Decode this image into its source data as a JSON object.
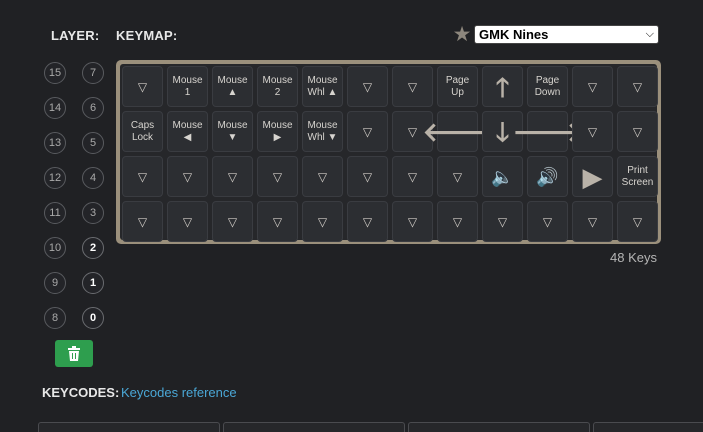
{
  "header": {
    "layer_label": "LAYER:",
    "keymap_label": "KEYMAP:"
  },
  "keymap_select": {
    "value": "GMK Nines",
    "chevron": "⌵",
    "favorite_icon": "star-icon"
  },
  "layers": {
    "left_column": [
      "15",
      "14",
      "13",
      "12",
      "11",
      "10",
      "9",
      "8"
    ],
    "right_column": [
      "7",
      "6",
      "5",
      "4",
      "3",
      "2",
      "1",
      "0"
    ],
    "highlighted": [
      "2",
      "1",
      "0"
    ],
    "delete_icon": "trash-icon",
    "delete_color": "#2e9e4e"
  },
  "keyboard": {
    "case_color": "#9b907c",
    "rows": [
      [
        "▽",
        "Mouse\n1",
        "Mouse\n▲",
        "Mouse\n2",
        "Mouse\nWhl ▲",
        "▽",
        "▽",
        "Page\nUp",
        "🡑",
        "Page\nDown",
        "▽",
        "▽"
      ],
      [
        "Caps\nLock",
        "Mouse\n◀",
        "Mouse\n▼",
        "Mouse\n▶",
        "Mouse\nWhl ▼",
        "▽",
        "▽",
        "🡐",
        "🡓",
        "🡒",
        "▽",
        "▽"
      ],
      [
        "▽",
        "▽",
        "▽",
        "▽",
        "▽",
        "▽",
        "▽",
        "▽",
        "🔈",
        "🔊",
        "▶",
        "Print\nScreen"
      ],
      [
        "▽",
        "▽",
        "▽",
        "▽",
        "▽",
        "▽",
        "▽",
        "▽",
        "▽",
        "▽",
        "▽",
        "▽"
      ]
    ]
  },
  "key_count": {
    "value": "48",
    "unit": "Keys"
  },
  "keycodes": {
    "label": "KEYCODES:",
    "link": "Keycodes reference"
  }
}
